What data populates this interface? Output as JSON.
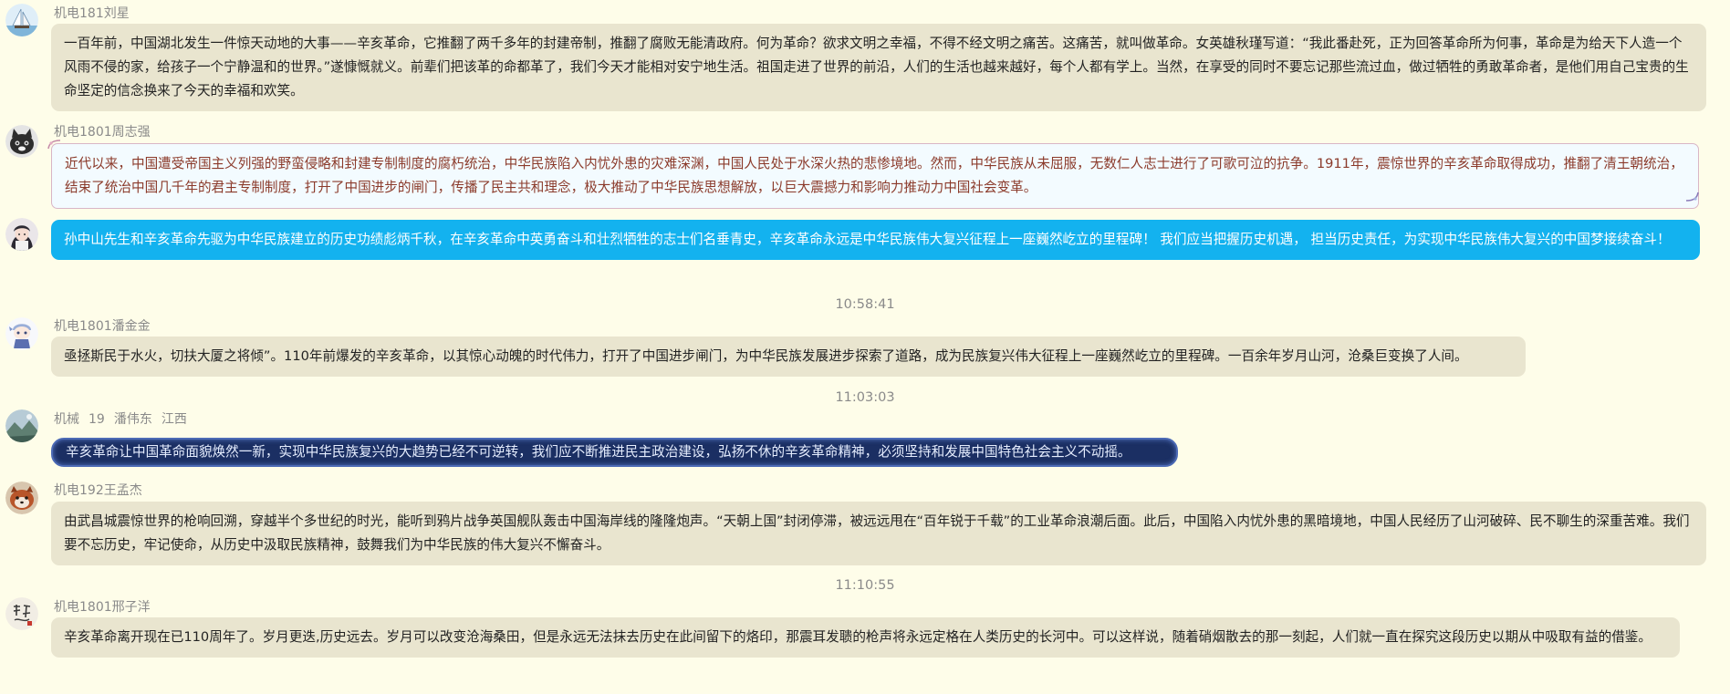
{
  "messages": [
    {
      "sender": "机电181刘星",
      "text": "一百年前，中国湖北发生一件惊天动地的大事——辛亥革命，它推翻了两千多年的封建帝制，推翻了腐败无能清政府。何为革命？欲求文明之幸福，不得不经文明之痛苦。这痛苦，就叫做革命。女英雄秋瑾写道：“我此番赴死，正为回答革命所为何事，革命是为给天下人造一个风雨不侵的家，给孩子一个宁静温和的世界。”遂慷慨就义。前辈们把该革的命都革了，我们今天才能相对安宁地生活。祖国走进了世界的前沿，人们的生活也越来越好，每个人都有学上。当然，在享受的同时不要忘记那些流过血，做过牺牲的勇敢革命者，是他们用自己宝贵的生命坚定的信念换来了今天的幸福和欢笑。",
      "avatar_icon": "sailboat-avatar-icon"
    },
    {
      "sender": "机电1801周志强",
      "text": "近代以来，中国遭受帝国主义列强的野蛮侵略和封建专制制度的腐朽统治，中华民族陷入内忧外患的灾难深渊，中国人民处于水深火热的悲惨境地。然而，中华民族从未屈服，无数仁人志士进行了可歌可泣的抗争。1911年，震惊世界的辛亥革命取得成功，推翻了清王朝统治，结束了统治中国几千年的君主专制制度，打开了中国进步的闸门，传播了民主共和理念，极大推动了中华民族思想解放，以巨大震撼力和影响力推动力中国社会变革。",
      "avatar_icon": "cat-avatar-icon"
    },
    {
      "sender": "",
      "text": "孙中山先生和辛亥革命先驱为中华民族建立的历史功绩彪炳千秋，在辛亥革命中英勇奋斗和壮烈牺牲的志士们名垂青史，辛亥革命永远是中华民族伟大复兴征程上一座巍然屹立的里程碑！ 我们应当把握历史机遇， 担当历史责任，为实现中华民族伟大复兴的中国梦接续奋斗！",
      "avatar_icon": "anime-girl-avatar-icon"
    },
    {
      "timestamp": "10:58:41"
    },
    {
      "sender": "机电1801潘金金",
      "text": "亟拯斯民于水火，切扶大厦之将倾”。110年前爆发的辛亥革命，以其惊心动魄的时代伟力，打开了中国进步闸门，为中华民族发展进步探索了道路，成为民族复兴伟大征程上一座巍然屹立的里程碑。一百余年岁月山河，沧桑巨变换了人间。",
      "avatar_icon": "chibi-character-avatar-icon"
    },
    {
      "timestamp": "11:03:03"
    },
    {
      "sender_parts": [
        "机械",
        "19",
        "潘伟东",
        "江西"
      ],
      "text": "辛亥革命让中国革命面貌焕然一新，实现中华民族复兴的大趋势已经不可逆转，我们应不断推进民主政治建设，弘扬不休的辛亥革命精神，必须坚持和发展中国特色社会主义不动摇。",
      "avatar_icon": "landscape-avatar-icon"
    },
    {
      "sender": "机电192王孟杰",
      "text": "由武昌城震惊世界的枪响回溯，穿越半个多世纪的时光，能听到鸦片战争英国舰队轰击中国海岸线的隆隆炮声。“天朝上国”封闭停滞，被远远甩在“百年锐于千载”的工业革命浪潮后面。此后，中国陷入内忧外患的黑暗境地，中国人民经历了山河破碎、民不聊生的深重苦难。我们要不忘历史，牢记使命，从历史中汲取民族精神，鼓舞我们为中华民族的伟大复兴不懈奋斗。",
      "avatar_icon": "red-panda-avatar-icon"
    },
    {
      "timestamp": "11:10:55"
    },
    {
      "sender": "机电1801邢子洋",
      "text": "辛亥革命离开现在已110周年了。岁月更迭,历史远去。岁月可以改变沧海桑田，但是永远无法抹去历史在此间留下的烙印，那震耳发聩的枪声将永远定格在人类历史的长河中。可以这样说，随着硝烟散去的那一刻起，人们就一直在探究这段历史以期从中吸取有益的借鉴。",
      "avatar_icon": "calligraphy-avatar-icon"
    }
  ],
  "colors": {
    "background": "#fefde9",
    "bubble_default": "#e9e5cf",
    "bubble_blue": "#13b2ef",
    "bubble_dark": "#1b2f63",
    "bubble_frame_text": "#8b3a2a",
    "meta_text": "#8a8a8a"
  }
}
